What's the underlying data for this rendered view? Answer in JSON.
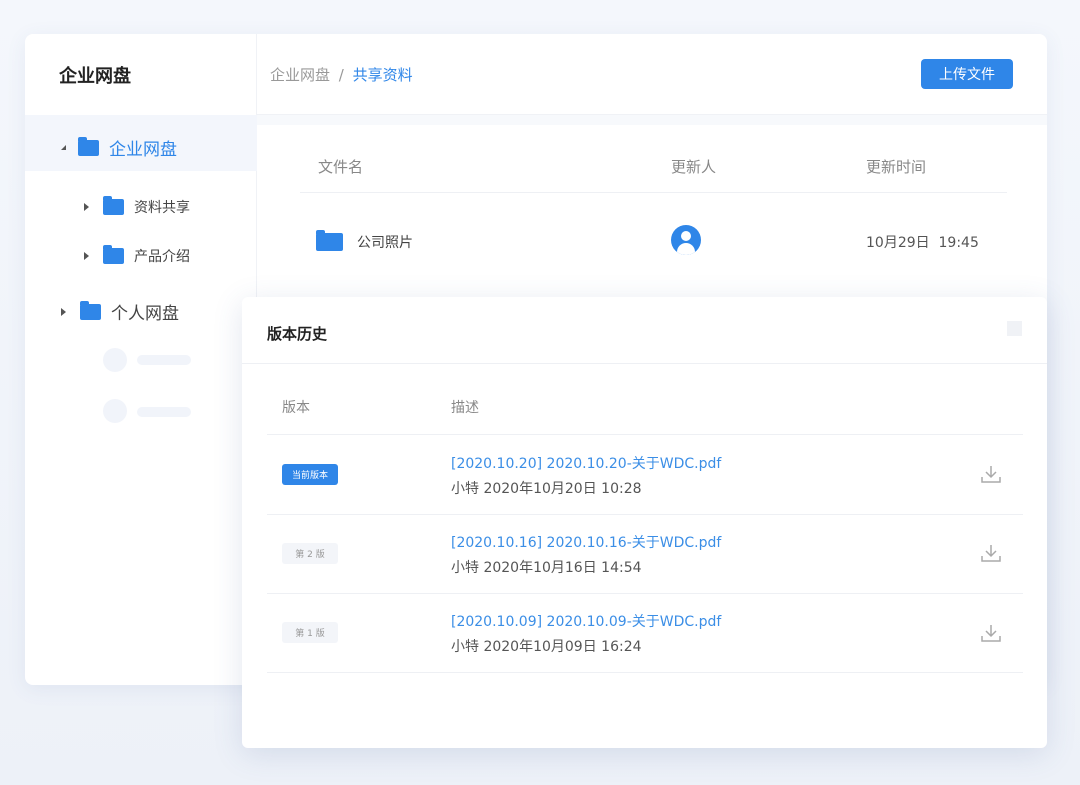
{
  "app": {
    "title": "企业网盘"
  },
  "sidebar": {
    "items": [
      {
        "label": "企业网盘",
        "expanded": true,
        "selected": true
      },
      {
        "label": "资料共享"
      },
      {
        "label": "产品介绍"
      },
      {
        "label": "个人网盘"
      }
    ]
  },
  "breadcrumb": {
    "root": "企业网盘",
    "sep": "/",
    "current": "共享资料"
  },
  "toolbar": {
    "upload_label": "上传文件"
  },
  "table": {
    "headers": [
      "文件名",
      "更新人",
      "更新时间"
    ],
    "rows": [
      {
        "name": "公司照片",
        "time": "10月29日  19:45"
      }
    ]
  },
  "modal": {
    "title": "版本历史",
    "headers": [
      "版本",
      "描述"
    ],
    "versions": [
      {
        "badge": "当前版本",
        "current": true,
        "file": "[2020.10.20] 2020.10.20-关于WDC.pdf",
        "meta": "小特 2020年10月20日 10:28"
      },
      {
        "badge": "第 2 版",
        "current": false,
        "file": "[2020.10.16] 2020.10.16-关于WDC.pdf",
        "meta": "小特 2020年10月16日 14:54"
      },
      {
        "badge": "第 1 版",
        "current": false,
        "file": "[2020.10.09] 2020.10.09-关于WDC.pdf",
        "meta": "小特 2020年10月09日 16:24"
      }
    ]
  },
  "colors": {
    "accent": "#2f86e8"
  }
}
